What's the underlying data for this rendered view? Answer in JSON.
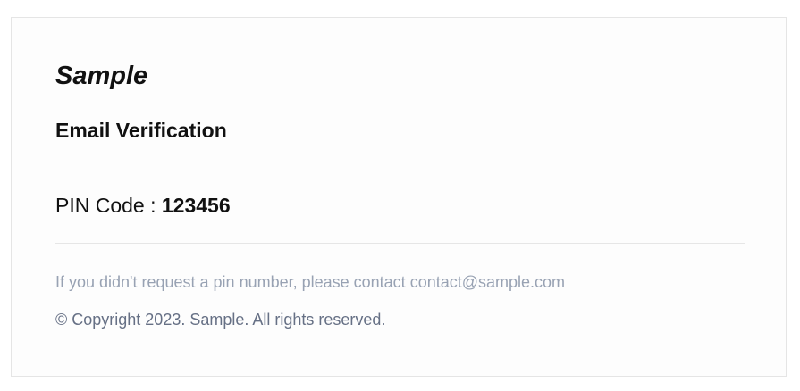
{
  "email": {
    "brand": "Sample",
    "heading": "Email Verification",
    "pin_label": "PIN Code : ",
    "pin_value": "123456",
    "notice_text": "If you didn't request a pin number, please contact ",
    "contact_email": "contact@sample.com",
    "copyright": "© Copyright 2023. Sample. All rights reserved."
  },
  "colors": {
    "text_primary": "#111111",
    "text_muted": "#98a2b3",
    "text_secondary": "#667085",
    "border": "#e5e5e5"
  }
}
